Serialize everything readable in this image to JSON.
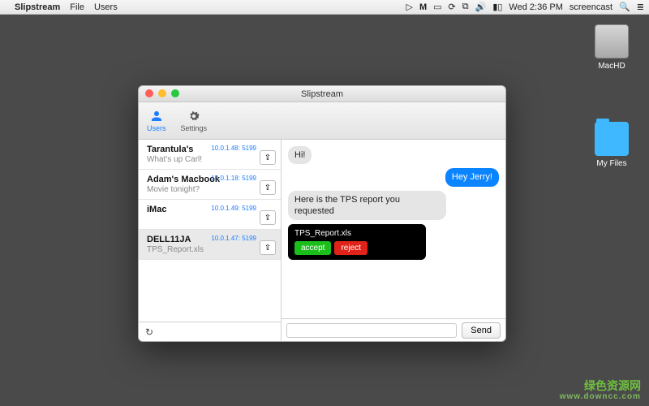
{
  "menubar": {
    "appname": "Slipstream",
    "menus": [
      "File",
      "Users"
    ],
    "right_time": "Wed 2:36 PM",
    "right_user": "screencast"
  },
  "desktop": {
    "hd_label": "MacHD",
    "folder_label": "My Files"
  },
  "window": {
    "title": "Slipstream",
    "toolbar": {
      "users": "Users",
      "settings": "Settings"
    }
  },
  "users": [
    {
      "name": "Tarantula's",
      "sub": "What's up Carl!",
      "addr": "10.0.1.48: 5199",
      "selected": false
    },
    {
      "name": "Adam's Macbook",
      "sub": "Movie tonight?",
      "addr": "10.0.1.18: 5199",
      "selected": false
    },
    {
      "name": "iMac",
      "sub": "",
      "addr": "10.0.1.49: 5199",
      "selected": false
    },
    {
      "name": "DELL11JA",
      "sub": "TPS_Report.xls",
      "addr": "10.0.1.47: 5199",
      "selected": true
    }
  ],
  "refresh_glyph": "↻",
  "share_glyph": "⇪",
  "messages": [
    {
      "dir": "in",
      "text": "Hi!"
    },
    {
      "dir": "out",
      "text": "Hey Jerry!"
    },
    {
      "dir": "in",
      "text": "Here is the TPS report you requested"
    }
  ],
  "file": {
    "name": "TPS_Report.xls",
    "accept": "accept",
    "reject": "reject"
  },
  "compose": {
    "placeholder": "",
    "send": "Send"
  },
  "watermark": {
    "line1": "绿色资源网",
    "line2": "www.downcc.com"
  }
}
